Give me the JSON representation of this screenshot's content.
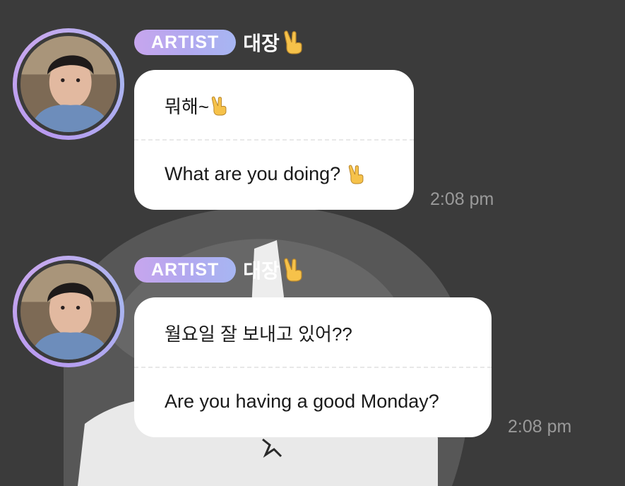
{
  "messages": [
    {
      "badge": "ARTIST",
      "sender": "대장",
      "korean": "뭐해~",
      "english": "What are you doing?",
      "time": "2:08 pm"
    },
    {
      "badge": "ARTIST",
      "sender": "대장",
      "korean": "월요일 잘 보내고 있어??",
      "english": "Are you having a good Monday?",
      "time": "2:08 pm"
    }
  ],
  "icons": {
    "sender_emoji": "victory-hand-icon",
    "message_emoji": "victory-hand-icon"
  },
  "colors": {
    "background": "#3b3b3b",
    "badge_gradient_start": "#c7a6ee",
    "badge_gradient_end": "#a7b6f2",
    "bubble": "#ffffff",
    "timestamp": "#9a9a9a"
  }
}
